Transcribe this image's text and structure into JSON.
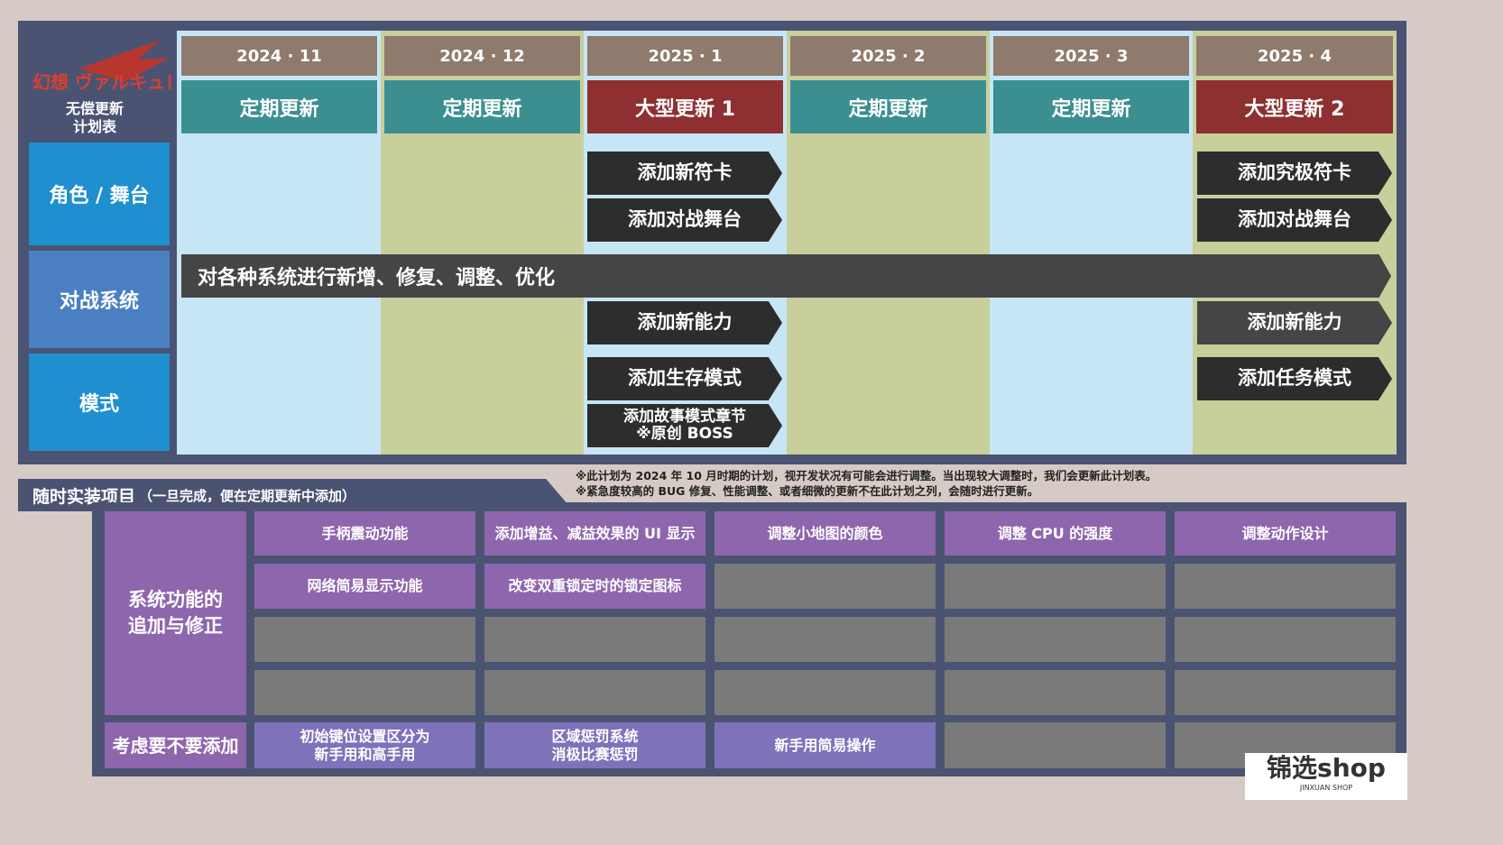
{
  "header": {
    "logo_text": "幻想 ヴァルキュレ",
    "title_line1": "无偿更新",
    "title_line2": "计划表"
  },
  "categories": [
    "角色 / 舞台",
    "对战系统",
    "模式"
  ],
  "months": [
    "2024 · 11",
    "2024 · 12",
    "2025 · 1",
    "2025 · 2",
    "2025 · 3",
    "2025 · 4"
  ],
  "updates": [
    "定期更新",
    "定期更新",
    "大型更新 1",
    "定期更新",
    "定期更新",
    "大型更新 2"
  ],
  "items_jan": {
    "card": "添加新符卡",
    "stage": "添加对战舞台",
    "ability": "添加新能力",
    "survival": "添加生存模式",
    "story_line1": "添加故事模式章节",
    "story_line2": "※原创 BOSS"
  },
  "items_apr": {
    "card": "添加究极符卡",
    "stage": "添加对战舞台",
    "ability": "添加新能力",
    "mission": "添加任务模式"
  },
  "system_bar": "对各种系统进行新增、修复、调整、优化",
  "notes": [
    "※此计划为 2024 年 10 月时期的计划，视开发状况有可能会进行调整。当出现较大调整时，我们会更新此计划表。",
    "※紧急度较高的 BUG 修复、性能调整、或者细微的更新不在此计划之列，会随时进行更新。"
  ],
  "bottom": {
    "title": "随时实装项目",
    "subtitle": "（一旦完成，便在定期更新中添加）",
    "row1_label": "系统功能的\n追加与修正",
    "row2_label": "考虑要不要添加",
    "system_items": [
      "手柄震动功能",
      "添加增益、减益效果的 UI 显示",
      "调整小地图的颜色",
      "调整 CPU 的强度",
      "调整动作设计",
      "网络简易显示功能",
      "改变双重锁定时的锁定图标"
    ],
    "consider_items": [
      "初始键位设置区分为\n新手用和高手用",
      "区域惩罚系统\n消极比赛惩罚",
      "新手用简易操作"
    ]
  },
  "watermark": {
    "brand": "锦选shop",
    "sub": "JINXUAN SHOP"
  }
}
